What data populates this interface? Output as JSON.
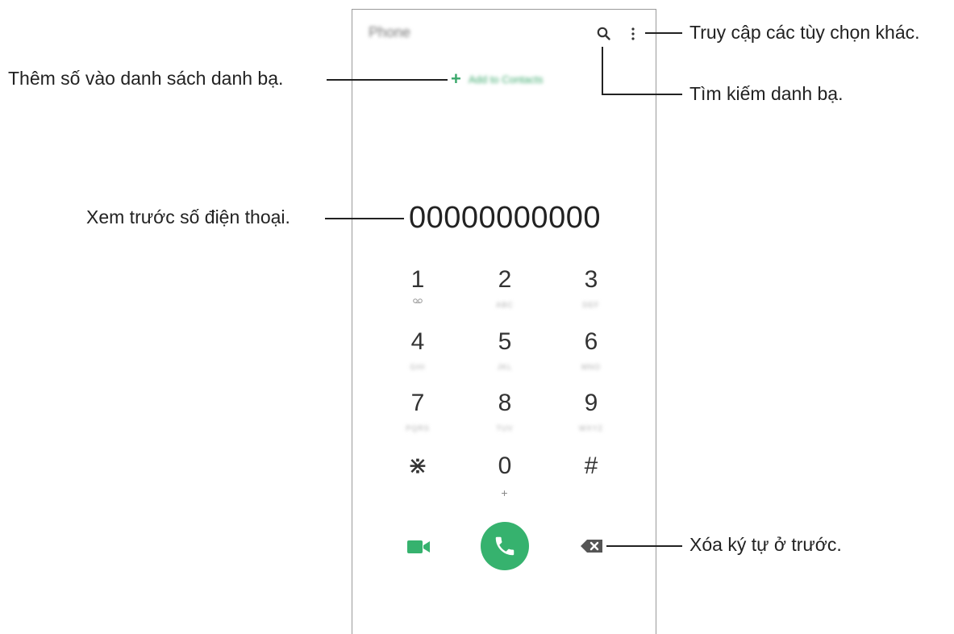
{
  "app": {
    "title": "Phone",
    "add_to_contacts": "Add to Contacts",
    "number_preview": "00000000000"
  },
  "keypad": [
    {
      "digit": "1",
      "sub": "voicemail-icon"
    },
    {
      "digit": "2",
      "sub": "ABC"
    },
    {
      "digit": "3",
      "sub": "DEF"
    },
    {
      "digit": "4",
      "sub": "GHI"
    },
    {
      "digit": "5",
      "sub": "JKL"
    },
    {
      "digit": "6",
      "sub": "MNO"
    },
    {
      "digit": "7",
      "sub": "PQRS"
    },
    {
      "digit": "8",
      "sub": "TUV"
    },
    {
      "digit": "9",
      "sub": "WXYZ"
    },
    {
      "digit": "⋇",
      "sub": ""
    },
    {
      "digit": "0",
      "sub": "+"
    },
    {
      "digit": "#",
      "sub": ""
    }
  ],
  "callouts": {
    "more_options": "Truy cập các tùy chọn khác.",
    "add_contacts": "Thêm số vào danh sách danh bạ.",
    "search_contacts": "Tìm kiếm danh bạ.",
    "preview_number": "Xem trước số điện thoại.",
    "delete_char": "Xóa ký tự ở trước."
  },
  "colors": {
    "accent": "#36b26e",
    "backspace": "#555555"
  },
  "icons": [
    "search-icon",
    "more-options-icon",
    "plus-icon",
    "voicemail-icon",
    "video-call-icon",
    "phone-icon",
    "backspace-icon"
  ]
}
